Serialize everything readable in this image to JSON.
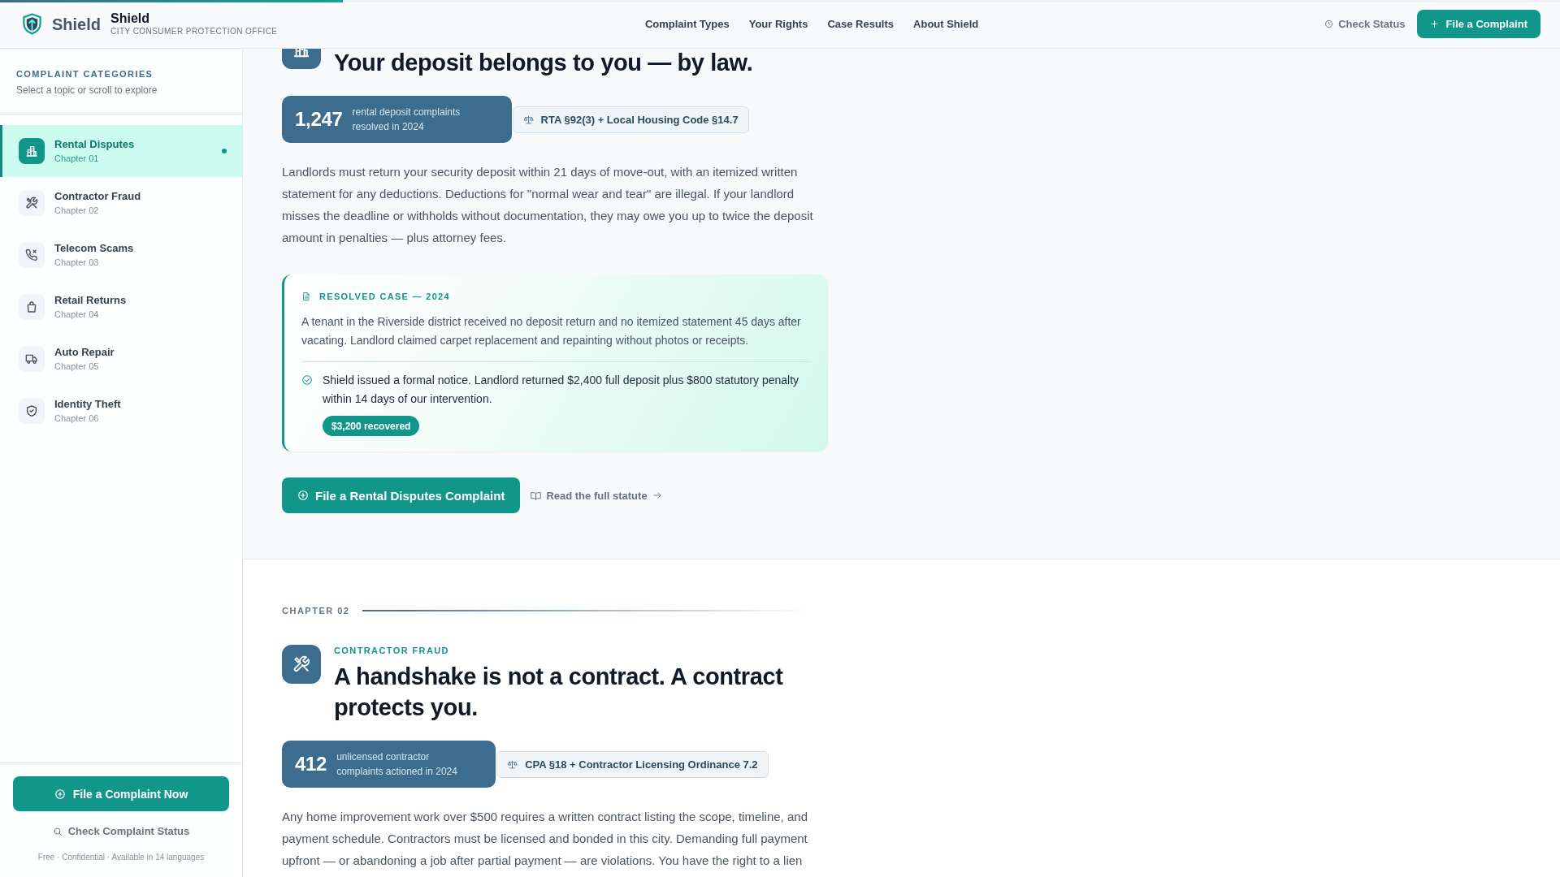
{
  "reading_progress": {
    "level": 0.22
  },
  "header": {
    "logo_text": "Shield",
    "brand_name": "Shield",
    "brand_subtitle": "CITY CONSUMER PROTECTION OFFICE",
    "nav": [
      "Complaint Types",
      "Your Rights",
      "Case Results",
      "About Shield"
    ],
    "check_status": "Check Status",
    "file_button": "File a Complaint"
  },
  "sidebar": {
    "heading": "COMPLAINT CATEGORIES",
    "subheading": "Select a topic or scroll to explore",
    "items": [
      {
        "title": "Rental Disputes",
        "chapter": "Chapter 01",
        "selected": true
      },
      {
        "title": "Contractor Fraud",
        "chapter": "Chapter 02",
        "selected": false
      },
      {
        "title": "Telecom Scams",
        "chapter": "Chapter 03",
        "selected": false
      },
      {
        "title": "Retail Returns",
        "chapter": "Chapter 04",
        "selected": false
      },
      {
        "title": "Auto Repair",
        "chapter": "Chapter 05",
        "selected": false
      },
      {
        "title": "Identity Theft",
        "chapter": "Chapter 06",
        "selected": false
      }
    ],
    "primary_button": "File a Complaint Now",
    "status_link": "Check Complaint Status",
    "footnote": "Free · Confidential · Available in 14 languages"
  },
  "sections": [
    {
      "heading": "Your deposit belongs to you — by law.",
      "stat": {
        "number": "1,247",
        "label": "rental deposit complaints resolved in 2024"
      },
      "law": "RTA §92(3) + Local Housing Code §14.7",
      "body": "Landlords must return your security deposit within 21 days of move-out, with an itemized written statement for any deductions. Deductions for \"normal wear and tear\" are illegal. If your landlord misses the deadline or withholds without documentation, they may owe you up to twice the deposit amount in penalties — plus attorney fees.",
      "case": {
        "label": "RESOLVED CASE — 2024",
        "description": "A tenant in the Riverside district received no deposit return and no itemized statement 45 days after vacating. Landlord claimed carpet replacement and repainting without photos or receipts.",
        "outcome": "Shield issued a formal notice. Landlord returned $2,400 full deposit plus $800 statutory penalty within 14 days of our intervention.",
        "badge": "$3,200 recovered"
      },
      "primary_button": "File a Rental Disputes Complaint",
      "link": "Read the full statute"
    },
    {
      "chapter": "CHAPTER 02",
      "eyebrow": "CONTRACTOR FRAUD",
      "heading": "A handshake is not a contract. A contract protects you.",
      "stat": {
        "number": "412",
        "label": "unlicensed contractor complaints actioned in 2024"
      },
      "law": "CPA §18 + Contractor Licensing Ordinance 7.2",
      "body": "Any home improvement work over $500 requires a written contract listing the scope, timeline, and payment schedule. Contractors must be licensed and bonded in this city. Demanding full payment upfront — or abandoning a job after partial payment — are violations. You have the right to a lien"
    }
  ]
}
